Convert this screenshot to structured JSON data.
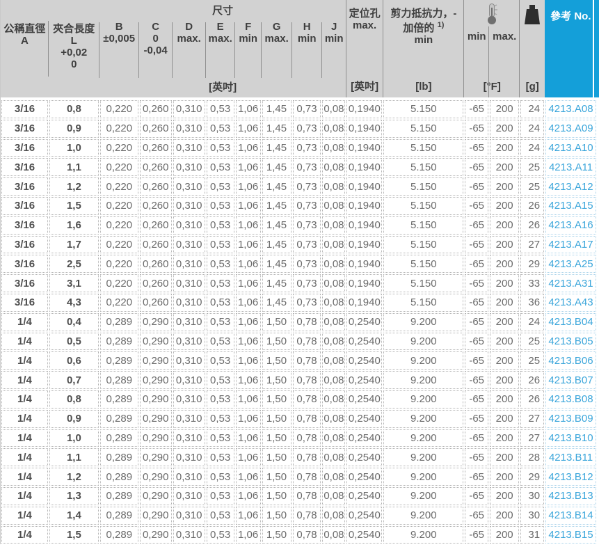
{
  "colors": {
    "accent_blue": "#149fd9",
    "link_blue": "#3ba6db",
    "header_gray": "#d2d2d2"
  },
  "table": {
    "header": {
      "col_a": {
        "line1": "公稱直徑",
        "line2": "A"
      },
      "col_l": {
        "line1": "夾合長度",
        "line2": "L",
        "line3": "+0,02",
        "line4": "0"
      },
      "dims_group": "尺寸",
      "dims_unit": "[英吋]",
      "letters": [
        {
          "name": "B",
          "sub": [
            "±0,005"
          ]
        },
        {
          "name": "C",
          "sub": [
            "0",
            "-0,04"
          ]
        },
        {
          "name": "D",
          "sub": [
            "max."
          ]
        },
        {
          "name": "E",
          "sub": [
            "max."
          ]
        },
        {
          "name": "F",
          "sub": [
            "min"
          ]
        },
        {
          "name": "G",
          "sub": [
            "max."
          ]
        },
        {
          "name": "H",
          "sub": [
            "min"
          ]
        },
        {
          "name": "J",
          "sub": [
            "min"
          ]
        }
      ],
      "hole": {
        "line1": "定位孔",
        "line2": "max.",
        "unit": "[英吋]"
      },
      "shear": {
        "line1": "剪力抵抗力，-",
        "line2": "加倍的",
        "sup": "1)",
        "line3": "min",
        "unit": "[lb]"
      },
      "temp": {
        "icon": "thermometer-icon",
        "min_label": "min",
        "max_label": "max.",
        "unit": "[°F]"
      },
      "weight": {
        "icon": "weight-icon",
        "unit": "[g]"
      },
      "ref": {
        "label": "參考 No."
      }
    },
    "rows": [
      [
        "3/16",
        "0,8",
        "0,220",
        "0,260",
        "0,310",
        "0,53",
        "1,06",
        "1,45",
        "0,73",
        "0,08",
        "0,1940",
        "5.150",
        "-65",
        "200",
        "24",
        "4213.A08"
      ],
      [
        "3/16",
        "0,9",
        "0,220",
        "0,260",
        "0,310",
        "0,53",
        "1,06",
        "1,45",
        "0,73",
        "0,08",
        "0,1940",
        "5.150",
        "-65",
        "200",
        "24",
        "4213.A09"
      ],
      [
        "3/16",
        "1,0",
        "0,220",
        "0,260",
        "0,310",
        "0,53",
        "1,06",
        "1,45",
        "0,73",
        "0,08",
        "0,1940",
        "5.150",
        "-65",
        "200",
        "24",
        "4213.A10"
      ],
      [
        "3/16",
        "1,1",
        "0,220",
        "0,260",
        "0,310",
        "0,53",
        "1,06",
        "1,45",
        "0,73",
        "0,08",
        "0,1940",
        "5.150",
        "-65",
        "200",
        "25",
        "4213.A11"
      ],
      [
        "3/16",
        "1,2",
        "0,220",
        "0,260",
        "0,310",
        "0,53",
        "1,06",
        "1,45",
        "0,73",
        "0,08",
        "0,1940",
        "5.150",
        "-65",
        "200",
        "25",
        "4213.A12"
      ],
      [
        "3/16",
        "1,5",
        "0,220",
        "0,260",
        "0,310",
        "0,53",
        "1,06",
        "1,45",
        "0,73",
        "0,08",
        "0,1940",
        "5.150",
        "-65",
        "200",
        "26",
        "4213.A15"
      ],
      [
        "3/16",
        "1,6",
        "0,220",
        "0,260",
        "0,310",
        "0,53",
        "1,06",
        "1,45",
        "0,73",
        "0,08",
        "0,1940",
        "5.150",
        "-65",
        "200",
        "26",
        "4213.A16"
      ],
      [
        "3/16",
        "1,7",
        "0,220",
        "0,260",
        "0,310",
        "0,53",
        "1,06",
        "1,45",
        "0,73",
        "0,08",
        "0,1940",
        "5.150",
        "-65",
        "200",
        "27",
        "4213.A17"
      ],
      [
        "3/16",
        "2,5",
        "0,220",
        "0,260",
        "0,310",
        "0,53",
        "1,06",
        "1,45",
        "0,73",
        "0,08",
        "0,1940",
        "5.150",
        "-65",
        "200",
        "29",
        "4213.A25"
      ],
      [
        "3/16",
        "3,1",
        "0,220",
        "0,260",
        "0,310",
        "0,53",
        "1,06",
        "1,45",
        "0,73",
        "0,08",
        "0,1940",
        "5.150",
        "-65",
        "200",
        "33",
        "4213.A31"
      ],
      [
        "3/16",
        "4,3",
        "0,220",
        "0,260",
        "0,310",
        "0,53",
        "1,06",
        "1,45",
        "0,73",
        "0,08",
        "0,1940",
        "5.150",
        "-65",
        "200",
        "36",
        "4213.A43"
      ],
      [
        "1/4",
        "0,4",
        "0,289",
        "0,290",
        "0,310",
        "0,53",
        "1,06",
        "1,50",
        "0,78",
        "0,08",
        "0,2540",
        "9.200",
        "-65",
        "200",
        "24",
        "4213.B04"
      ],
      [
        "1/4",
        "0,5",
        "0,289",
        "0,290",
        "0,310",
        "0,53",
        "1,06",
        "1,50",
        "0,78",
        "0,08",
        "0,2540",
        "9.200",
        "-65",
        "200",
        "25",
        "4213.B05"
      ],
      [
        "1/4",
        "0,6",
        "0,289",
        "0,290",
        "0,310",
        "0,53",
        "1,06",
        "1,50",
        "0,78",
        "0,08",
        "0,2540",
        "9.200",
        "-65",
        "200",
        "25",
        "4213.B06"
      ],
      [
        "1/4",
        "0,7",
        "0,289",
        "0,290",
        "0,310",
        "0,53",
        "1,06",
        "1,50",
        "0,78",
        "0,08",
        "0,2540",
        "9.200",
        "-65",
        "200",
        "26",
        "4213.B07"
      ],
      [
        "1/4",
        "0,8",
        "0,289",
        "0,290",
        "0,310",
        "0,53",
        "1,06",
        "1,50",
        "0,78",
        "0,08",
        "0,2540",
        "9.200",
        "-65",
        "200",
        "26",
        "4213.B08"
      ],
      [
        "1/4",
        "0,9",
        "0,289",
        "0,290",
        "0,310",
        "0,53",
        "1,06",
        "1,50",
        "0,78",
        "0,08",
        "0,2540",
        "9.200",
        "-65",
        "200",
        "27",
        "4213.B09"
      ],
      [
        "1/4",
        "1,0",
        "0,289",
        "0,290",
        "0,310",
        "0,53",
        "1,06",
        "1,50",
        "0,78",
        "0,08",
        "0,2540",
        "9.200",
        "-65",
        "200",
        "27",
        "4213.B10"
      ],
      [
        "1/4",
        "1,1",
        "0,289",
        "0,290",
        "0,310",
        "0,53",
        "1,06",
        "1,50",
        "0,78",
        "0,08",
        "0,2540",
        "9.200",
        "-65",
        "200",
        "28",
        "4213.B11"
      ],
      [
        "1/4",
        "1,2",
        "0,289",
        "0,290",
        "0,310",
        "0,53",
        "1,06",
        "1,50",
        "0,78",
        "0,08",
        "0,2540",
        "9.200",
        "-65",
        "200",
        "29",
        "4213.B12"
      ],
      [
        "1/4",
        "1,3",
        "0,289",
        "0,290",
        "0,310",
        "0,53",
        "1,06",
        "1,50",
        "0,78",
        "0,08",
        "0,2540",
        "9.200",
        "-65",
        "200",
        "30",
        "4213.B13"
      ],
      [
        "1/4",
        "1,4",
        "0,289",
        "0,290",
        "0,310",
        "0,53",
        "1,06",
        "1,50",
        "0,78",
        "0,08",
        "0,2540",
        "9.200",
        "-65",
        "200",
        "30",
        "4213.B14"
      ],
      [
        "1/4",
        "1,5",
        "0,289",
        "0,290",
        "0,310",
        "0,53",
        "1,06",
        "1,50",
        "0,78",
        "0,08",
        "0,2540",
        "9.200",
        "-65",
        "200",
        "31",
        "4213.B15"
      ]
    ]
  }
}
